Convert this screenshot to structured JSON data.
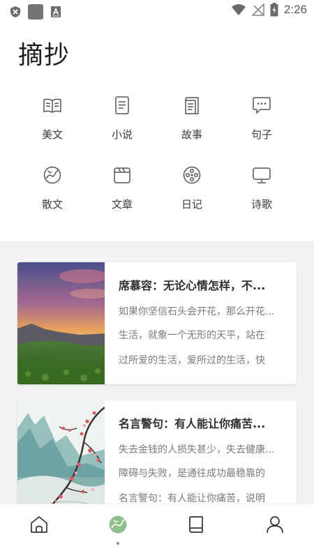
{
  "status_bar": {
    "time": "2:26",
    "icons": [
      "shield-icon",
      "app-square-icon",
      "a-box-icon",
      "wifi-icon",
      "no-signal-icon",
      "battery-charging-icon"
    ]
  },
  "header": {
    "title": "摘抄"
  },
  "categories": [
    {
      "label": "美文",
      "icon": "open-book-icon"
    },
    {
      "label": "小说",
      "icon": "novel-icon"
    },
    {
      "label": "故事",
      "icon": "story-icon"
    },
    {
      "label": "句子",
      "icon": "chat-bubble-icon"
    },
    {
      "label": "散文",
      "icon": "prose-circle-icon"
    },
    {
      "label": "文章",
      "icon": "clapper-icon"
    },
    {
      "label": "日记",
      "icon": "film-reel-icon"
    },
    {
      "label": "诗歌",
      "icon": "monitor-icon"
    }
  ],
  "articles": [
    {
      "title": "席慕容：无论心情怎样，不...",
      "lines": [
        "如果你坚信石头会开花，那么开花...",
        "生活，就象一个无形的天平，站在",
        "过所爱的生活，爱所过的生活，快"
      ],
      "image": "sunset-mountain-image"
    },
    {
      "title": "名言警句：有人能让你痛苦...",
      "lines": [
        "失去金钱的人损失甚少，失去健康...",
        "障碍与失败，是通往成功最稳靠的",
        "名言警句：有人能让你痛苦，说明"
      ],
      "image": "plum-blossom-painting-image"
    }
  ],
  "bottom_nav": {
    "items": [
      {
        "icon": "home-icon"
      },
      {
        "icon": "discover-icon",
        "active": true
      },
      {
        "icon": "book-icon"
      },
      {
        "icon": "profile-icon"
      }
    ]
  },
  "colors": {
    "accent_green": "#8fbf8a",
    "feed_background": "#f2f2f2",
    "icon_gray": "#555555"
  }
}
